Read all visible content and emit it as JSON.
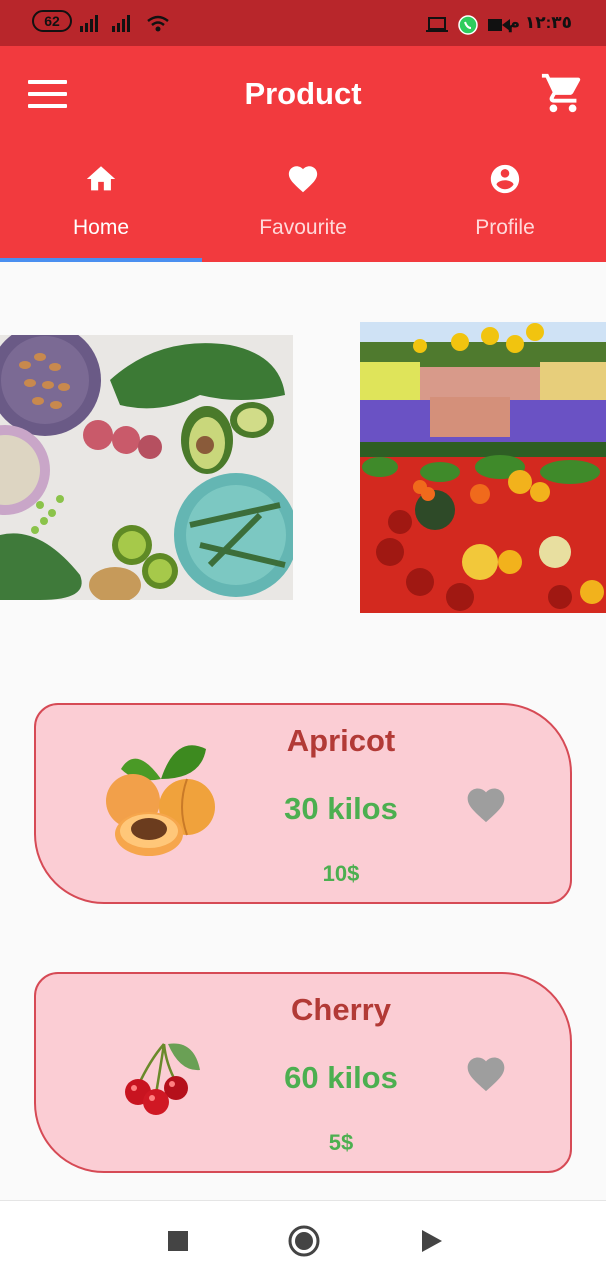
{
  "status_bar": {
    "battery": "62",
    "time": "١٢:٣٥ م"
  },
  "app_bar": {
    "title": "Product",
    "menu_icon": "hamburger-icon",
    "cart_icon": "shopping-cart-icon"
  },
  "tabs": [
    {
      "label": "Home",
      "icon": "home-icon",
      "active": true
    },
    {
      "label": "Favourite",
      "icon": "heart-icon",
      "active": false
    },
    {
      "label": "Profile",
      "icon": "account-circle-icon",
      "active": false
    }
  ],
  "gallery": [
    {
      "subject": "vegetables-flatlay-photo"
    },
    {
      "subject": "market-vegetables-flowers-photo"
    }
  ],
  "products": [
    {
      "name": "Apricot",
      "quantity": "30 kilos",
      "price": "10$",
      "image": "apricot-image"
    },
    {
      "name": "Cherry",
      "quantity": "60 kilos",
      "price": "5$",
      "image": "cherry-image"
    }
  ],
  "colors": {
    "app_bar": "#f23a3e",
    "status_bar": "#b8262b",
    "card_bg": "#fbcdd4",
    "card_border": "#d64a55",
    "name_text": "#b23a36",
    "qty_text": "#4caf50",
    "tab_indicator": "#4a8ff0"
  },
  "system_nav": [
    "stop-square-icon",
    "home-circle-icon",
    "back-play-icon"
  ]
}
